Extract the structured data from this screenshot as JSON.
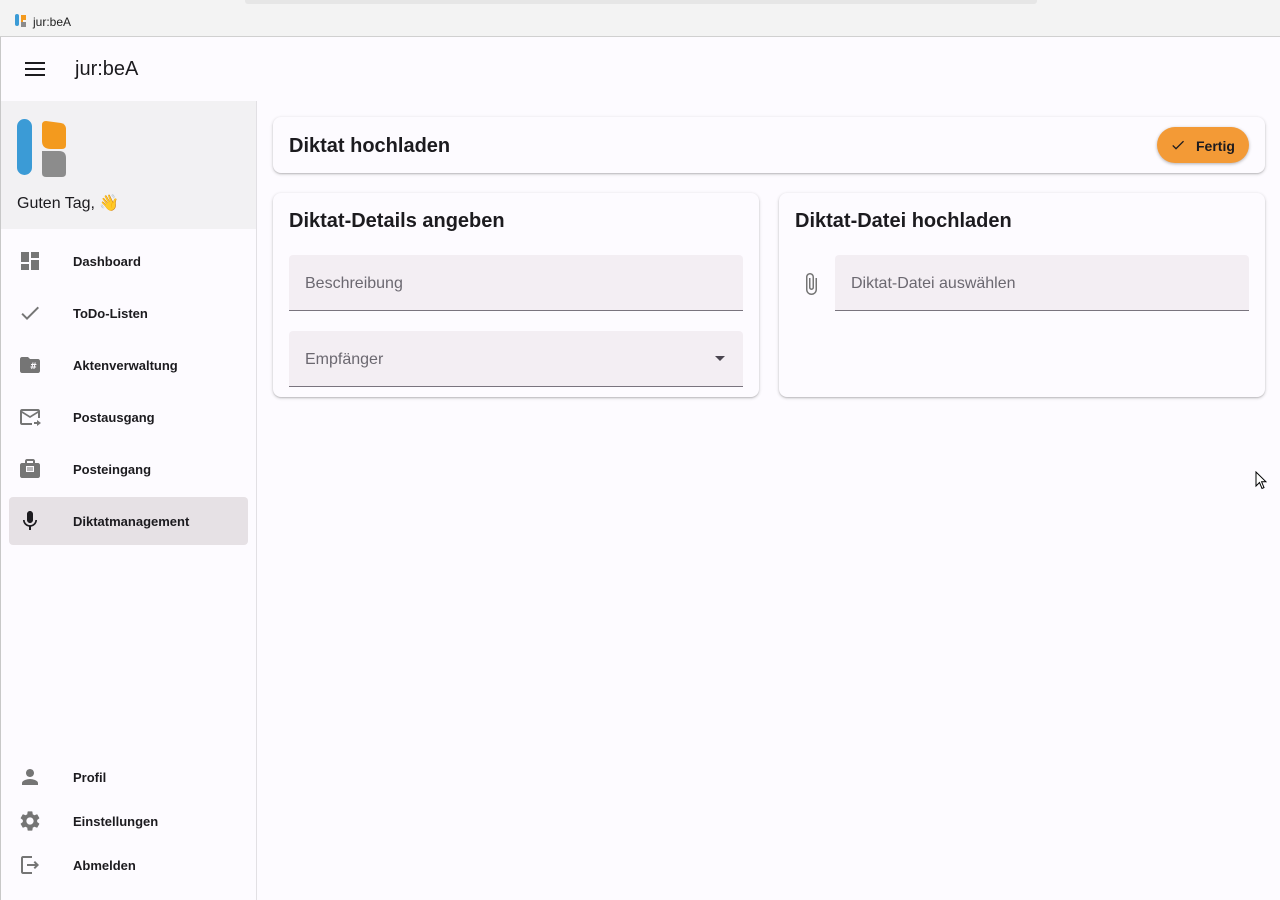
{
  "window": {
    "title": "jur:beA"
  },
  "appbar": {
    "title": "jur:beA",
    "menu_icon": "menu-icon"
  },
  "sidebar": {
    "greeting": "Guten Tag, 👋",
    "items": [
      {
        "label": "Dashboard",
        "icon": "dashboard-icon"
      },
      {
        "label": "ToDo-Listen",
        "icon": "check-icon"
      },
      {
        "label": "Aktenverwaltung",
        "icon": "folder-hash-icon"
      },
      {
        "label": "Postausgang",
        "icon": "mail-outgoing-icon"
      },
      {
        "label": "Posteingang",
        "icon": "inbox-icon"
      },
      {
        "label": "Diktatmanagement",
        "icon": "microphone-icon",
        "active": true
      }
    ],
    "bottom_items": [
      {
        "label": "Profil",
        "icon": "person-icon"
      },
      {
        "label": "Einstellungen",
        "icon": "gear-icon"
      },
      {
        "label": "Abmelden",
        "icon": "logout-icon"
      }
    ]
  },
  "main": {
    "header": {
      "title": "Diktat hochladen",
      "done_label": "Fertig"
    },
    "details": {
      "title": "Diktat-Details angeben",
      "description_placeholder": "Beschreibung",
      "recipient_placeholder": "Empfänger"
    },
    "upload": {
      "title": "Diktat-Datei hochladen",
      "file_placeholder": "Diktat-Datei auswählen"
    }
  },
  "colors": {
    "accent": "#f39a36",
    "active_nav": "#e6e1e5",
    "logo_blue": "#3b9bd6",
    "logo_orange": "#f39a1e",
    "logo_gray": "#8c8c8c"
  }
}
